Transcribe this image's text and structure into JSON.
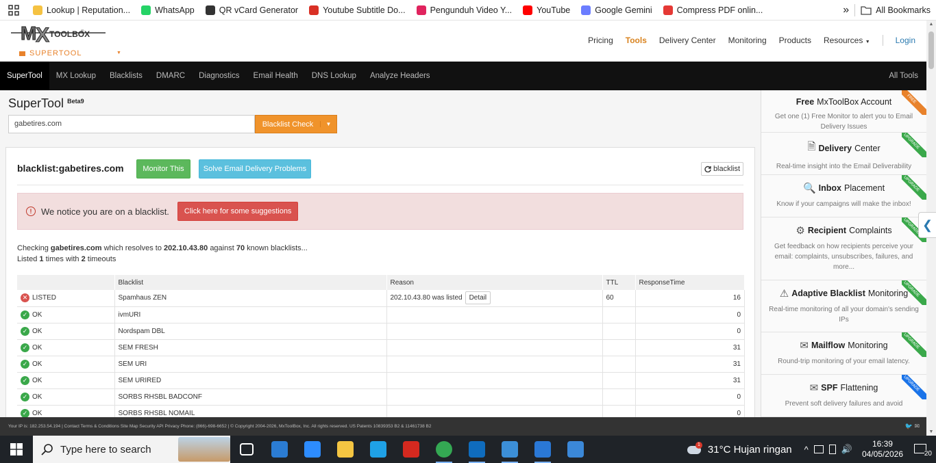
{
  "bookmarks": {
    "items": [
      {
        "label": "Lookup | Reputation...",
        "icon": "reputation-icon",
        "color": "#f5c242"
      },
      {
        "label": "WhatsApp",
        "icon": "whatsapp-icon",
        "color": "#25d366"
      },
      {
        "label": "QR vCard Generator",
        "icon": "qr-icon",
        "color": "#333333"
      },
      {
        "label": "Youtube Subtitle Do...",
        "icon": "subtitle-icon",
        "color": "#d93025"
      },
      {
        "label": "Pengunduh Video Y...",
        "icon": "downloader-icon",
        "color": "#e0245e"
      },
      {
        "label": "YouTube",
        "icon": "youtube-icon",
        "color": "#ff0000"
      },
      {
        "label": "Google Gemini",
        "icon": "gemini-icon",
        "color": "#6b7dff"
      },
      {
        "label": "Compress PDF onlin...",
        "icon": "heart-icon",
        "color": "#e53935"
      }
    ],
    "more": "»",
    "all_bookmarks": "All Bookmarks"
  },
  "header": {
    "logo_text": "MX TOOLBOX",
    "supertool_label": "SUPERTOOL",
    "nav": [
      "Pricing",
      "Tools",
      "Delivery Center",
      "Monitoring",
      "Products",
      "Resources",
      "Login"
    ],
    "active": "Tools"
  },
  "navbar": {
    "items": [
      "SuperTool",
      "MX Lookup",
      "Blacklists",
      "DMARC",
      "Diagnostics",
      "Email Health",
      "DNS Lookup",
      "Analyze Headers"
    ],
    "all_tools": "All Tools"
  },
  "supertool": {
    "title": "SuperTool",
    "beta": "Beta9",
    "input_value": "gabetires.com",
    "check_button": "Blacklist Check",
    "caret": "▼"
  },
  "result": {
    "title": "blacklist:gabetires.com",
    "monitor_button": "Monitor This",
    "solve_button": "Solve Email Delivery Problems",
    "refresh_button": "blacklist",
    "alert_text": "We notice you are on a blacklist.",
    "alert_button": "Click here for some suggestions",
    "checking_prefix": "Checking",
    "domain": "gabetires.com",
    "resolves_text": "which resolves to",
    "ip": "202.10.43.80",
    "against_text": "against",
    "count": "70",
    "known_text": "known blacklists...",
    "listed_prefix": "Listed",
    "listed_count": "1",
    "times_with": "times with",
    "timeouts_count": "2",
    "timeouts_text": "timeouts"
  },
  "table": {
    "headers": [
      "",
      "Blacklist",
      "Reason",
      "TTL",
      "ResponseTime"
    ],
    "rows": [
      {
        "status": "LISTED",
        "blacklist": "Spamhaus ZEN",
        "reason": "202.10.43.80 was listed",
        "detail": "Detail",
        "ttl": "60",
        "time": "16"
      },
      {
        "status": "OK",
        "blacklist": "ivmURI",
        "reason": "",
        "detail": "",
        "ttl": "",
        "time": "0"
      },
      {
        "status": "OK",
        "blacklist": "Nordspam DBL",
        "reason": "",
        "detail": "",
        "ttl": "",
        "time": "0"
      },
      {
        "status": "OK",
        "blacklist": "SEM FRESH",
        "reason": "",
        "detail": "",
        "ttl": "",
        "time": "31"
      },
      {
        "status": "OK",
        "blacklist": "SEM URI",
        "reason": "",
        "detail": "",
        "ttl": "",
        "time": "31"
      },
      {
        "status": "OK",
        "blacklist": "SEM URIRED",
        "reason": "",
        "detail": "",
        "ttl": "",
        "time": "31"
      },
      {
        "status": "OK",
        "blacklist": "SORBS RHSBL BADCONF",
        "reason": "",
        "detail": "",
        "ttl": "",
        "time": "0"
      },
      {
        "status": "OK",
        "blacklist": "SORBS RHSBL NOMAIL",
        "reason": "",
        "detail": "",
        "ttl": "",
        "time": "0"
      }
    ]
  },
  "sidebar": {
    "boxes": [
      {
        "title_bold": "Free",
        "title_rest": "MxToolBox Account",
        "desc": "Get one (1) Free Monitor to alert you to Email Delivery Issues",
        "ribbon": "FREE",
        "ribbon_color": "#e8822b",
        "icon": ""
      },
      {
        "title_bold": "Delivery",
        "title_rest": "Center",
        "desc": "Real-time insight into the Email Deliverability",
        "ribbon": "UPGRADE",
        "ribbon_color": "#3aa84a",
        "icon": "document-icon"
      },
      {
        "title_bold": "Inbox",
        "title_rest": "Placement",
        "desc": "Know if your campaigns will make the inbox!",
        "ribbon": "UPGRADE",
        "ribbon_color": "#3aa84a",
        "icon": "magnifier-icon"
      },
      {
        "title_bold": "Recipient",
        "title_rest": "Complaints",
        "desc": "Get feedback on how recipients perceive your email: complaints, unsubscribes, failures, and more...",
        "ribbon": "UPGRADE",
        "ribbon_color": "#3aa84a",
        "icon": "gears-icon"
      },
      {
        "title_bold": "Adaptive Blacklist",
        "title_rest": "Monitoring",
        "desc": "Real-time monitoring of all your domain's sending IPs",
        "ribbon": "UPGRADE",
        "ribbon_color": "#3aa84a",
        "icon": "warning-icon"
      },
      {
        "title_bold": "Mailflow",
        "title_rest": "Monitoring",
        "desc": "Round-trip monitoring of your email latency.",
        "ribbon": "UPGRADE",
        "ribbon_color": "#3aa84a",
        "icon": "mail-icon"
      },
      {
        "title_bold": "SPF",
        "title_rest": "Flattening",
        "desc": "Prevent soft delivery failures and avoid",
        "ribbon": "UPGRADE",
        "ribbon_color": "#1a73e8",
        "icon": "mail-icon"
      }
    ]
  },
  "footer": {
    "text": "Your IP is: 182.253.54.194 | Contact Terms & Conditions Site Map Security API Privacy Phone: (866)-698-6652 | © Copyright 2004-2026, MxToolBox, Inc. All rights reserved. US Patents 10839353 B2 & 11461738 B2"
  },
  "taskbar": {
    "search_placeholder": "Type here to search",
    "weather": "31°C  Hujan ringan",
    "time": "16:39",
    "date": "04/05/2026",
    "notif_count": "20",
    "apps": [
      {
        "name": "task-view-icon",
        "color": "#ffffff"
      },
      {
        "name": "store-icon",
        "color": "#2b7cd3"
      },
      {
        "name": "zoom-icon",
        "color": "#2d8cff"
      },
      {
        "name": "file-explorer-icon",
        "color": "#f4c542"
      },
      {
        "name": "edge-icon",
        "color": "#1fa1e6"
      },
      {
        "name": "pdf-icon",
        "color": "#d4291f"
      },
      {
        "name": "chrome-icon",
        "color": "#34a853"
      },
      {
        "name": "outlook-icon",
        "color": "#0f6cbd"
      },
      {
        "name": "remote-desktop-icon",
        "color": "#3c8fd8"
      },
      {
        "name": "app-icon",
        "color": "#2a78d6"
      },
      {
        "name": "photos-icon",
        "color": "#3b88d8"
      }
    ]
  }
}
